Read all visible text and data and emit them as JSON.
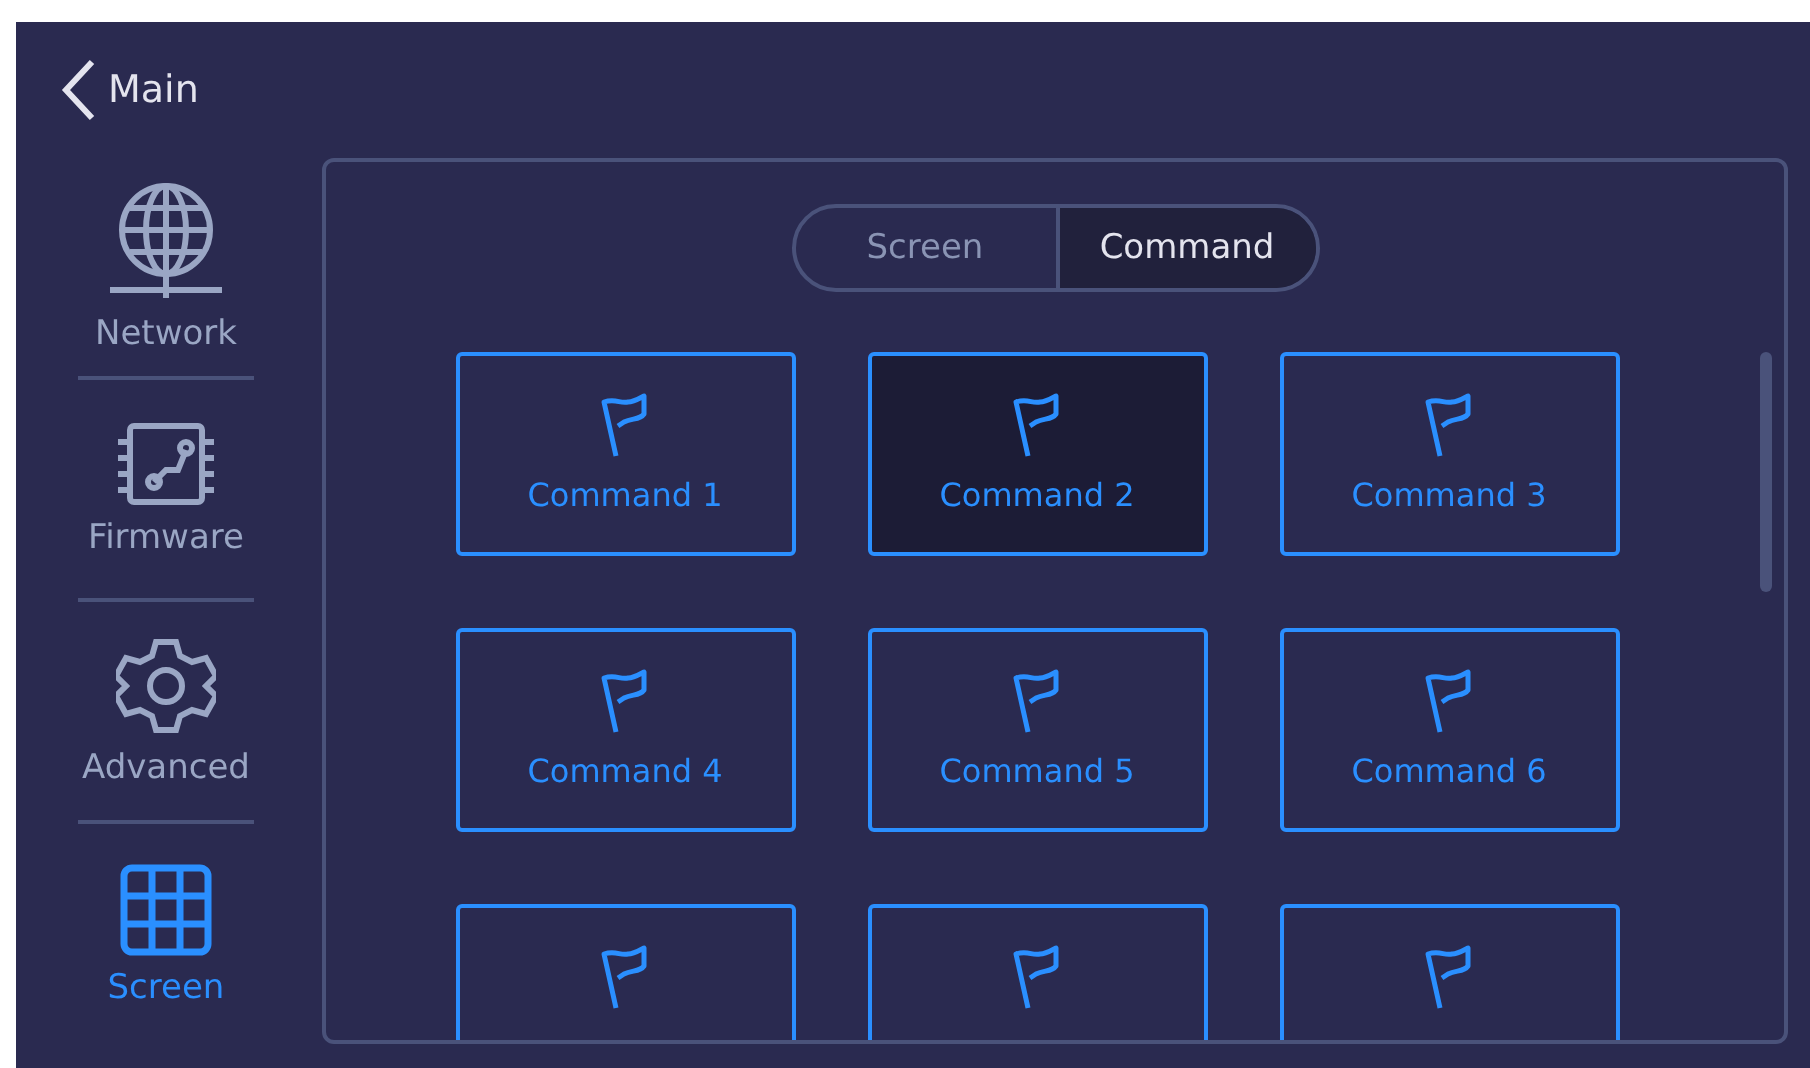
{
  "header": {
    "back_label": "Main"
  },
  "sidebar": {
    "items": [
      {
        "label": "Network",
        "kind": "globe",
        "selected": false
      },
      {
        "label": "Firmware",
        "kind": "chip",
        "selected": false
      },
      {
        "label": "Advanced",
        "kind": "gear",
        "selected": false
      },
      {
        "label": "Screen",
        "kind": "grid",
        "selected": true
      }
    ]
  },
  "segmented": [
    {
      "label": "Screen",
      "selected": false
    },
    {
      "label": "Command",
      "selected": true
    }
  ],
  "commands": [
    {
      "label": "Command 1",
      "selected": false
    },
    {
      "label": "Command 2",
      "selected": true
    },
    {
      "label": "Command 3",
      "selected": false
    },
    {
      "label": "Command 4",
      "selected": false
    },
    {
      "label": "Command 5",
      "selected": false
    },
    {
      "label": "Command 6",
      "selected": false
    },
    {
      "selected": false
    },
    {
      "selected": false
    },
    {
      "selected": false
    }
  ]
}
